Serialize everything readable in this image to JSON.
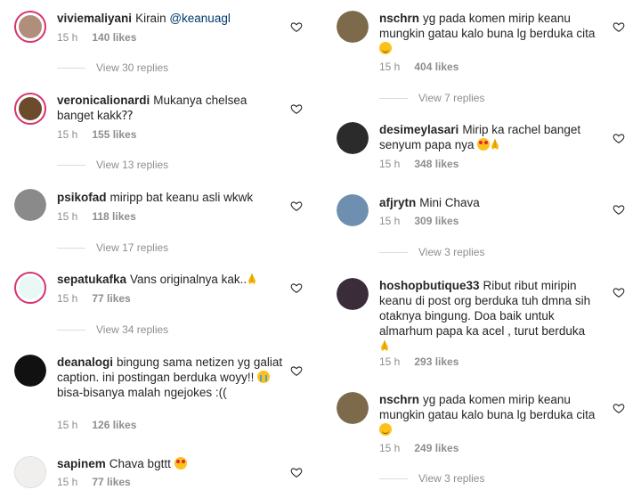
{
  "left": [
    {
      "user": "viviemaliyani",
      "text": "Kirain ",
      "mention": "@keanuagl",
      "time": "15 h",
      "likes": "140 likes",
      "replies": "View 30 replies",
      "avatar": "#b08e7c",
      "ring": true
    },
    {
      "user": "veronicalionardi",
      "text": "Mukanya chelsea banget kakk⁇",
      "time": "15 h",
      "likes": "155 likes",
      "replies": "View 13 replies",
      "avatar": "#6b4b2b",
      "ring": true
    },
    {
      "user": "psikofad",
      "text": "miripp bat keanu asli wkwk",
      "time": "15 h",
      "likes": "118 likes",
      "replies": "View 17 replies",
      "avatar": "#8a8a8a",
      "ring": false
    },
    {
      "user": "sepatukafka",
      "text": "Vans originalnya kak..",
      "emoji": "pray",
      "time": "15 h",
      "likes": "77 likes",
      "replies": "View 34 replies",
      "avatar": "#e9f7f5",
      "ring": true
    },
    {
      "user": "deanalogi",
      "text": "bingung sama netizen yg galiat caption. ini postingan berduka woyy!! ",
      "emoji": "cry",
      "text2": " bisa-bisanya malah ngejokes :((",
      "time": "15 h",
      "likes": "126 likes",
      "avatar": "#111111",
      "ring": false
    },
    {
      "user": "sapinem",
      "text": "Chava bgttt ",
      "emoji": "heart-eyes",
      "time": "15 h",
      "likes": "77 likes",
      "avatar": "#f1eeee",
      "ring": false
    }
  ],
  "right": [
    {
      "user": "nschrn",
      "text": "yg pada komen mirip keanu mungkin gatau kalo buna lg berduka cita",
      "emoji": "smile",
      "time": "15 h",
      "likes": "404 likes",
      "replies": "View 7 replies",
      "avatar": "#7c6a4b",
      "ring": false
    },
    {
      "user": "desimeylasari",
      "text": "Mirip ka rachel banget senyum papa nya ",
      "emoji": "heart-eyes",
      "emoji2": "pray",
      "time": "15 h",
      "likes": "348 likes",
      "avatar": "#2b2b2b",
      "ring": false
    },
    {
      "user": "afjrytn",
      "text": "Mini Chava",
      "time": "15 h",
      "likes": "309 likes",
      "replies": "View 3 replies",
      "avatar": "#6e8fb0",
      "ring": false
    },
    {
      "user": "hoshopbutique33",
      "text": "Ribut ribut miripin keanu di post org berduka tuh dmna sih otaknya bingung. Doa baik untuk almarhum papa ka acel , turut berduka",
      "emoji": "pray",
      "time": "15 h",
      "likes": "293 likes",
      "avatar": "#3a2c38",
      "ring": false
    },
    {
      "user": "nschrn",
      "text": "yg pada komen mirip keanu mungkin gatau kalo buna lg berduka cita",
      "emoji": "smile",
      "time": "15 h",
      "likes": "249 likes",
      "replies": "View 3 replies",
      "avatar": "#7c6a4b",
      "ring": false
    }
  ]
}
